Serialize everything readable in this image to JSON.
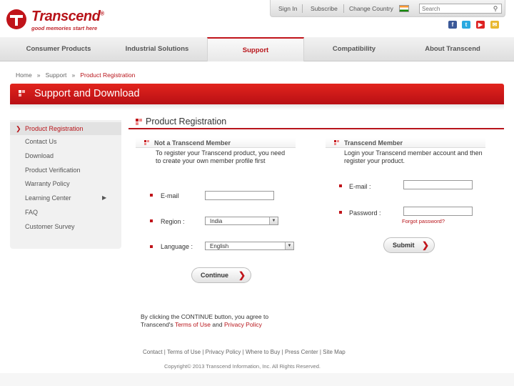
{
  "brand": {
    "name": "Transcend",
    "reg": "®",
    "tagline": "good memories start here"
  },
  "topbar": {
    "sign_in": "Sign In",
    "subscribe": "Subscribe",
    "change_country": "Change Country",
    "search_placeholder": "Search"
  },
  "social": [
    "facebook-icon",
    "twitter-icon",
    "youtube-icon",
    "mail-icon"
  ],
  "nav": [
    {
      "label": "Consumer Products"
    },
    {
      "label": "Industrial Solutions"
    },
    {
      "label": "Support"
    },
    {
      "label": "Compatibility"
    },
    {
      "label": "About Transcend"
    }
  ],
  "breadcrumb": {
    "home": "Home",
    "sep": "»",
    "support": "Support",
    "current": "Product Registration"
  },
  "banner": {
    "title": "Support and Download"
  },
  "sidebar": {
    "items": [
      {
        "label": "Product Registration"
      },
      {
        "label": "Contact Us"
      },
      {
        "label": "Download"
      },
      {
        "label": "Product Verification"
      },
      {
        "label": "Warranty Policy"
      },
      {
        "label": "Learning Center"
      },
      {
        "label": "FAQ"
      },
      {
        "label": "Customer Survey"
      }
    ]
  },
  "page_title": "Product Registration",
  "non_member": {
    "heading": "Not a Transcend Member",
    "desc": "To register your Transcend product, you need to create your own member profile first",
    "email_label": "E-mail",
    "region_label": "Region :",
    "region_value": "India",
    "language_label": "Language :",
    "language_value": "English",
    "continue_label": "Continue"
  },
  "member": {
    "heading": "Transcend Member",
    "desc": "Login your Transcend member account and then register your product.",
    "email_label": "E-mail :",
    "password_label": "Password :",
    "forgot": "Forgot password?",
    "submit_label": "Submit"
  },
  "agreement": {
    "prefix": "By clicking the CONTINUE button, you agree to",
    "brand": "Transcend's",
    "terms": "Terms of Use",
    "and": "and",
    "privacy": "Privacy Policy"
  },
  "footer": {
    "links": [
      "Contact",
      "Terms of Use",
      "Privacy Policy",
      "Where to Buy",
      "Press Center",
      "Site Map"
    ],
    "copyright": "Copyright© 2013 Transcend Information, Inc. All Rights Reserved."
  },
  "colors": {
    "accent": "#b8141a",
    "banner_top": "#e2241d",
    "banner_bottom": "#b80f14"
  }
}
